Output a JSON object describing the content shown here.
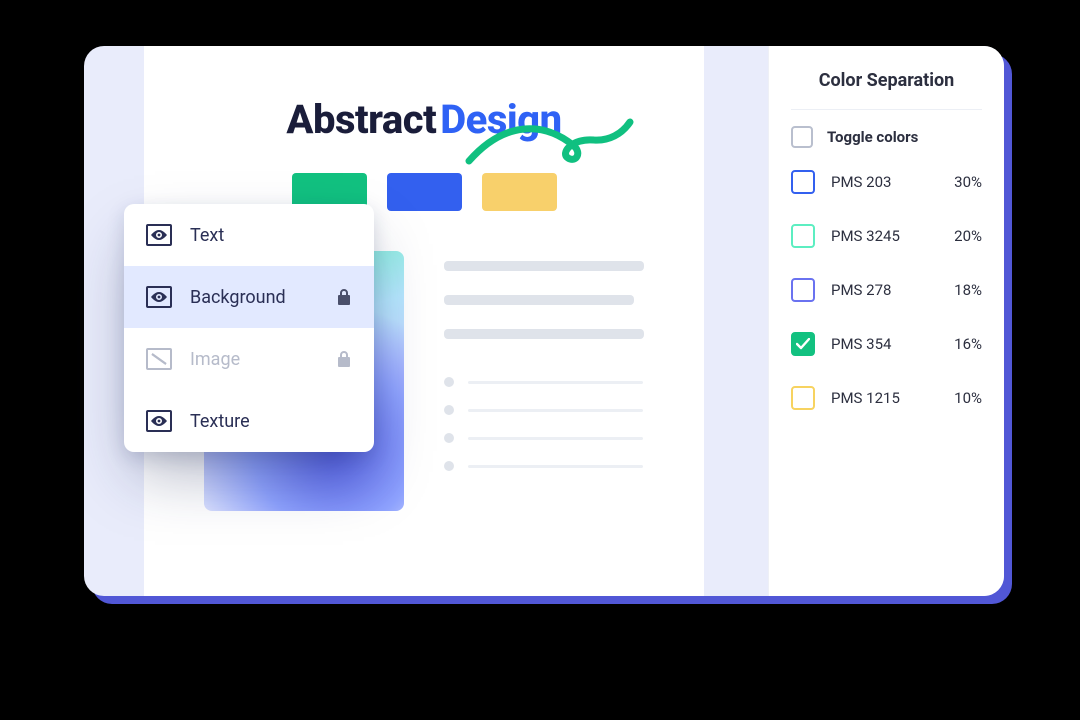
{
  "canvas": {
    "title_word1": "Abstract",
    "title_word2": "Design",
    "swatches": [
      "#12c180",
      "#3360ef",
      "#f8d06b"
    ]
  },
  "layers": {
    "items": [
      {
        "label": "Text",
        "visible": true,
        "locked": false,
        "selected": false,
        "disabled": false
      },
      {
        "label": "Background",
        "visible": true,
        "locked": true,
        "selected": true,
        "disabled": false
      },
      {
        "label": "Image",
        "visible": false,
        "locked": true,
        "selected": false,
        "disabled": true
      },
      {
        "label": "Texture",
        "visible": true,
        "locked": false,
        "selected": false,
        "disabled": false
      }
    ]
  },
  "sidebar": {
    "title": "Color Separation",
    "toggle_label": "Toggle colors",
    "colors": [
      {
        "name": "PMS 203",
        "pct": "30%",
        "border": "#3360ef",
        "checked": false
      },
      {
        "name": "PMS 3245",
        "pct": "20%",
        "border": "#5ceec1",
        "checked": false
      },
      {
        "name": "PMS 278",
        "pct": "18%",
        "border": "#6a72f0",
        "checked": false
      },
      {
        "name": "PMS 354",
        "pct": "16%",
        "border": "#12c180",
        "checked": true
      },
      {
        "name": "PMS 1215",
        "pct": "10%",
        "border": "#f7d360",
        "checked": false
      }
    ]
  }
}
